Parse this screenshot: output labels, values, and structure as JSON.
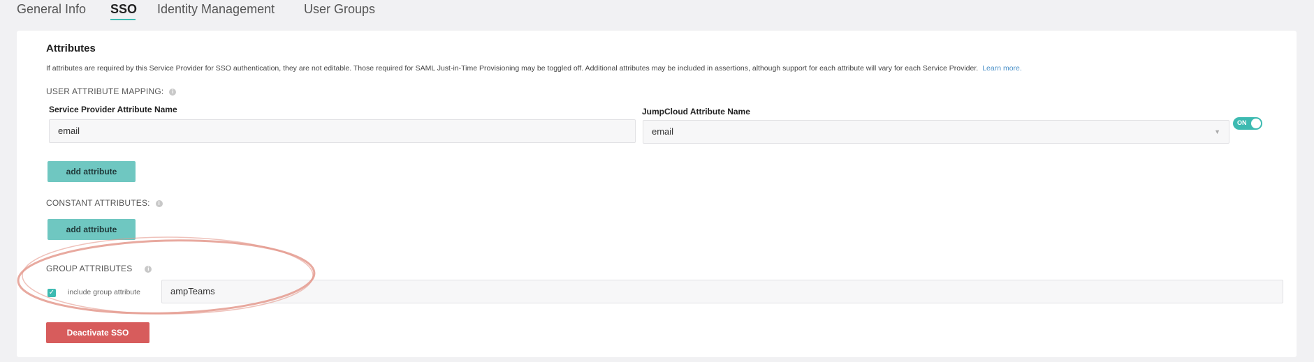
{
  "tabs": [
    {
      "label": "General Info"
    },
    {
      "label": "SSO"
    },
    {
      "label": "Identity Management"
    },
    {
      "label": "User Groups"
    }
  ],
  "attributes": {
    "title": "Attributes",
    "description": "If attributes are required by this Service Provider for SSO authentication, they are not editable. Those required for SAML Just-in-Time Provisioning may be toggled off. Additional attributes may be included in assertions, although support for each attribute will vary for each Service Provider.",
    "learn_more": "Learn more."
  },
  "user_mapping": {
    "section_label": "USER ATTRIBUTE MAPPING:",
    "sp_label": "Service Provider Attribute Name",
    "jc_label": "JumpCloud Attribute Name",
    "sp_value": "email",
    "jc_value": "email",
    "toggle_label": "ON",
    "add_label": "add attribute"
  },
  "constant": {
    "section_label": "CONSTANT ATTRIBUTES:",
    "add_label": "add attribute"
  },
  "group": {
    "section_label": "GROUP ATTRIBUTES",
    "checkbox_label": "include group attribute",
    "value": "ampTeams",
    "checked": true
  },
  "deactivate_label": "Deactivate SSO",
  "colors": {
    "accent": "#3dbab1",
    "button_teal": "#6fc7c1",
    "danger": "#d75c5c",
    "annotation": "#e49a8e"
  },
  "icons": {
    "info": "info-icon",
    "checkmark": "check-icon",
    "select_caret": "chevron-down-icon"
  }
}
